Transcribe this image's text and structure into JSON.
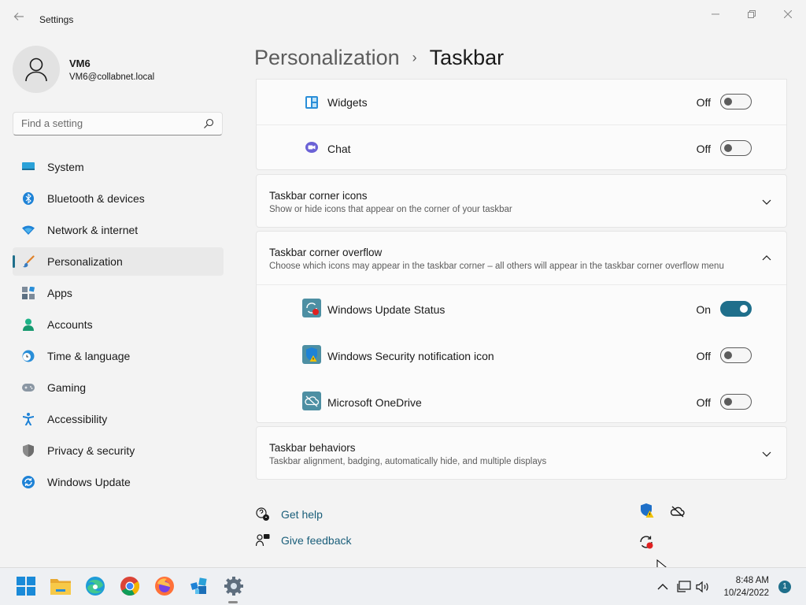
{
  "window": {
    "title": "Settings",
    "back_icon": "arrow-left-icon",
    "controls": [
      "minimize-icon",
      "maximize-icon",
      "close-icon"
    ]
  },
  "profile": {
    "name": "VM6",
    "email": "VM6@collabnet.local"
  },
  "search": {
    "placeholder": "Find a setting"
  },
  "sidebar": {
    "items": [
      {
        "label": "System",
        "icon": "monitor-icon"
      },
      {
        "label": "Bluetooth & devices",
        "icon": "bluetooth-icon"
      },
      {
        "label": "Network & internet",
        "icon": "wifi-icon"
      },
      {
        "label": "Personalization",
        "icon": "brush-icon",
        "active": true
      },
      {
        "label": "Apps",
        "icon": "apps-icon"
      },
      {
        "label": "Accounts",
        "icon": "person-icon"
      },
      {
        "label": "Time & language",
        "icon": "clock-globe-icon"
      },
      {
        "label": "Gaming",
        "icon": "gamepad-icon"
      },
      {
        "label": "Accessibility",
        "icon": "accessibility-icon"
      },
      {
        "label": "Privacy & security",
        "icon": "shield-icon"
      },
      {
        "label": "Windows Update",
        "icon": "sync-icon"
      }
    ]
  },
  "breadcrumb": {
    "parent": "Personalization",
    "separator": "›",
    "current": "Taskbar"
  },
  "taskbar_items": {
    "widgets": {
      "label": "Widgets",
      "state": "Off"
    },
    "chat": {
      "label": "Chat",
      "state": "Off"
    }
  },
  "corner_icons": {
    "title": "Taskbar corner icons",
    "subtitle": "Show or hide icons that appear on the corner of your taskbar"
  },
  "corner_overflow": {
    "title": "Taskbar corner overflow",
    "subtitle": "Choose which icons may appear in the taskbar corner – all others will appear in the taskbar corner overflow menu",
    "items": [
      {
        "label": "Windows Update Status",
        "state": "On"
      },
      {
        "label": "Windows Security notification icon",
        "state": "Off"
      },
      {
        "label": "Microsoft OneDrive",
        "state": "Off"
      }
    ]
  },
  "behaviors": {
    "title": "Taskbar behaviors",
    "subtitle": "Taskbar alignment, badging, automatically hide, and multiple displays"
  },
  "help": {
    "get_help": "Get help",
    "give_feedback": "Give feedback"
  },
  "system_taskbar": {
    "apps": [
      "windows-start-icon",
      "file-explorer-icon",
      "edge-icon",
      "chrome-icon",
      "firefox-icon",
      "app-icon",
      "settings-gear-icon"
    ],
    "time": "8:48 AM",
    "date": "10/24/2022",
    "notifications": "1"
  },
  "colors": {
    "accent": "#1f6f8b",
    "window_bg": "#f3f3f3",
    "card_bg": "#fbfbfb"
  }
}
